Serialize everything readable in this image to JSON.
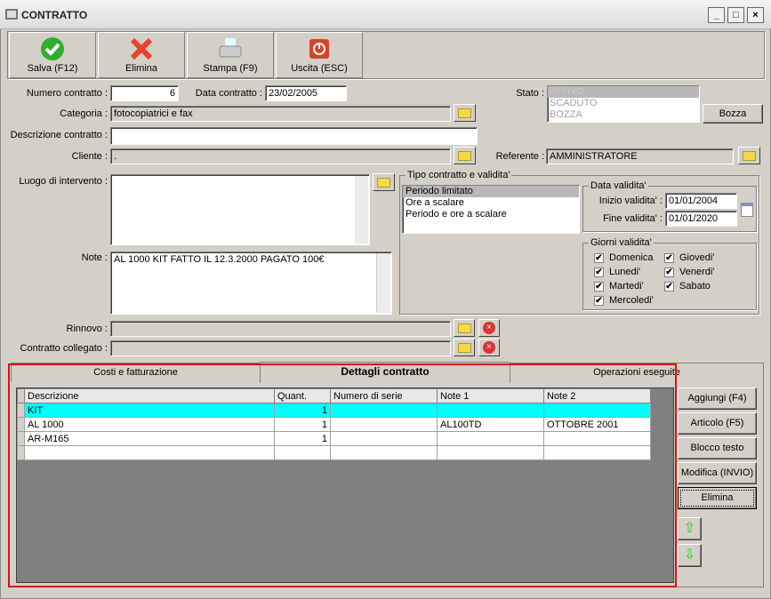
{
  "window": {
    "title": "CONTRATTO",
    "min": "_",
    "max": "□",
    "close": "×"
  },
  "toolbar": {
    "save": "Salva (F12)",
    "delete": "Elimina",
    "print": "Stampa (F9)",
    "exit": "Uscita (ESC)"
  },
  "form": {
    "numero_label": "Numero contratto :",
    "numero": "6",
    "data_label": "Data contratto :",
    "data": "23/02/2005",
    "stato_label": "Stato :",
    "stato_options": [
      "ATTIVO",
      "SCADUTO",
      "BOZZA"
    ],
    "bozza_button": "Bozza",
    "categoria_label": "Categoria :",
    "categoria": "fotocopiatrici e fax",
    "descrizione_label": "Descrizione contratto :",
    "descrizione": "",
    "cliente_label": "Cliente :",
    "cliente": ".",
    "referente_label": "Referente :",
    "referente": "AMMINISTRATORE",
    "luogo_label": "Luogo di intervento :",
    "luogo": "",
    "note_label": "Note :",
    "note": "AL 1000  KIT FATTO IL 12.3.2000 PAGATO 100€",
    "rinnovo_label": "Rinnovo :",
    "rinnovo": "",
    "collegato_label": "Contratto collegato :",
    "collegato": ""
  },
  "tipo": {
    "title": "Tipo contratto e validita'",
    "options": [
      "Periodo limitato",
      "Ore a scalare",
      "Periodo e ore a scalare"
    ],
    "data_title": "Data validita'",
    "inizio_label": "Inizio validita' :",
    "inizio": "01/01/2004",
    "fine_label": "Fine validita' :",
    "fine": "01/01/2020",
    "giorni_title": "Giorni validita'",
    "giorni": [
      {
        "label": "Domenica",
        "checked": true
      },
      {
        "label": "Lunedi'",
        "checked": true
      },
      {
        "label": "Martedi'",
        "checked": true
      },
      {
        "label": "Mercoledi'",
        "checked": true
      },
      {
        "label": "Giovedi'",
        "checked": true
      },
      {
        "label": "Venerdi'",
        "checked": true
      },
      {
        "label": "Sabato",
        "checked": true
      }
    ],
    "check_mark": "✔"
  },
  "tabs": [
    "Costi e fatturazione",
    "Dettagli contratto",
    "Operazioni eseguite"
  ],
  "grid": {
    "columns": [
      "Descrizione",
      "Quant.",
      "Numero di serie",
      "Note 1",
      "Note 2"
    ],
    "rows": [
      [
        "KIT",
        "1",
        "",
        "",
        ""
      ],
      [
        "AL 1000",
        "1",
        "",
        "AL100TD",
        "OTTOBRE 2001"
      ],
      [
        "AR-M165",
        "1",
        "",
        "",
        ""
      ],
      [
        "",
        "",
        "",
        "",
        ""
      ]
    ]
  },
  "side_buttons": [
    "Aggiungi (F4)",
    "Articolo (F5)",
    "Blocco testo",
    "Modifica (INVIO)",
    "Elimina"
  ],
  "colors": {
    "selected_row": "#00ffff",
    "highlight": "#dd1111"
  }
}
